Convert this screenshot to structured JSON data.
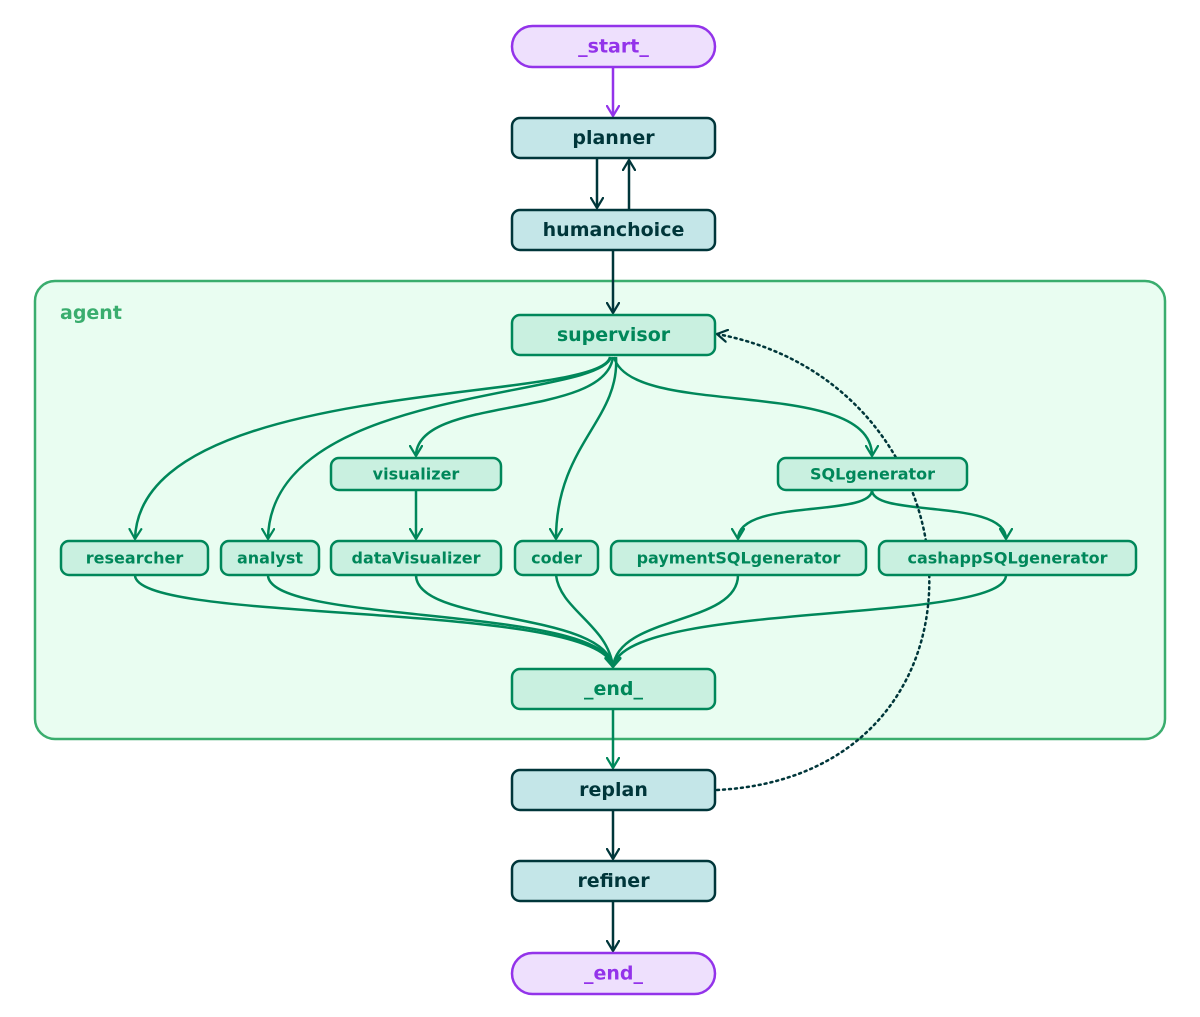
{
  "colors": {
    "terminal_fill": "#eee0fd",
    "terminal_stroke": "#9333ea",
    "main_fill": "#c4e6e8",
    "main_stroke": "#00363a",
    "agent_fill": "#c9f0e0",
    "agent_stroke": "#00875a",
    "cluster_fill": "#e9fdf1",
    "cluster_stroke": "#3aad6e"
  },
  "cluster": {
    "label": "agent"
  },
  "nodes": [
    {
      "id": "start",
      "label": "_start_",
      "kind": "terminal"
    },
    {
      "id": "planner",
      "label": "planner",
      "kind": "main"
    },
    {
      "id": "humanchoice",
      "label": "humanchoice",
      "kind": "main"
    },
    {
      "id": "supervisor",
      "label": "supervisor",
      "kind": "agent"
    },
    {
      "id": "visualizer",
      "label": "visualizer",
      "kind": "agent"
    },
    {
      "id": "SQLgenerator",
      "label": "SQLgenerator",
      "kind": "agent"
    },
    {
      "id": "researcher",
      "label": "researcher",
      "kind": "agent"
    },
    {
      "id": "analyst",
      "label": "analyst",
      "kind": "agent"
    },
    {
      "id": "dataVisualizer",
      "label": "dataVisualizer",
      "kind": "agent"
    },
    {
      "id": "coder",
      "label": "coder",
      "kind": "agent"
    },
    {
      "id": "paymentSQLgenerator",
      "label": "paymentSQLgenerator",
      "kind": "agent"
    },
    {
      "id": "cashappSQLgenerator",
      "label": "cashappSQLgenerator",
      "kind": "agent"
    },
    {
      "id": "agent_end",
      "label": "_end_",
      "kind": "agent"
    },
    {
      "id": "replan",
      "label": "replan",
      "kind": "main"
    },
    {
      "id": "refiner",
      "label": "refiner",
      "kind": "main"
    },
    {
      "id": "end",
      "label": "_end_",
      "kind": "terminal"
    }
  ],
  "edges": [
    {
      "from": "start",
      "to": "planner",
      "style": "solid"
    },
    {
      "from": "planner",
      "to": "humanchoice",
      "style": "solid"
    },
    {
      "from": "humanchoice",
      "to": "planner",
      "style": "solid"
    },
    {
      "from": "humanchoice",
      "to": "supervisor",
      "style": "solid"
    },
    {
      "from": "supervisor",
      "to": "researcher",
      "style": "solid"
    },
    {
      "from": "supervisor",
      "to": "analyst",
      "style": "solid"
    },
    {
      "from": "supervisor",
      "to": "visualizer",
      "style": "solid"
    },
    {
      "from": "supervisor",
      "to": "coder",
      "style": "solid"
    },
    {
      "from": "supervisor",
      "to": "SQLgenerator",
      "style": "solid"
    },
    {
      "from": "visualizer",
      "to": "dataVisualizer",
      "style": "solid"
    },
    {
      "from": "SQLgenerator",
      "to": "paymentSQLgenerator",
      "style": "solid"
    },
    {
      "from": "SQLgenerator",
      "to": "cashappSQLgenerator",
      "style": "solid"
    },
    {
      "from": "researcher",
      "to": "agent_end",
      "style": "solid"
    },
    {
      "from": "analyst",
      "to": "agent_end",
      "style": "solid"
    },
    {
      "from": "dataVisualizer",
      "to": "agent_end",
      "style": "solid"
    },
    {
      "from": "coder",
      "to": "agent_end",
      "style": "solid"
    },
    {
      "from": "paymentSQLgenerator",
      "to": "agent_end",
      "style": "solid"
    },
    {
      "from": "cashappSQLgenerator",
      "to": "agent_end",
      "style": "solid"
    },
    {
      "from": "agent_end",
      "to": "replan",
      "style": "solid"
    },
    {
      "from": "replan",
      "to": "supervisor",
      "style": "dotted"
    },
    {
      "from": "replan",
      "to": "refiner",
      "style": "solid"
    },
    {
      "from": "refiner",
      "to": "end",
      "style": "solid"
    }
  ]
}
